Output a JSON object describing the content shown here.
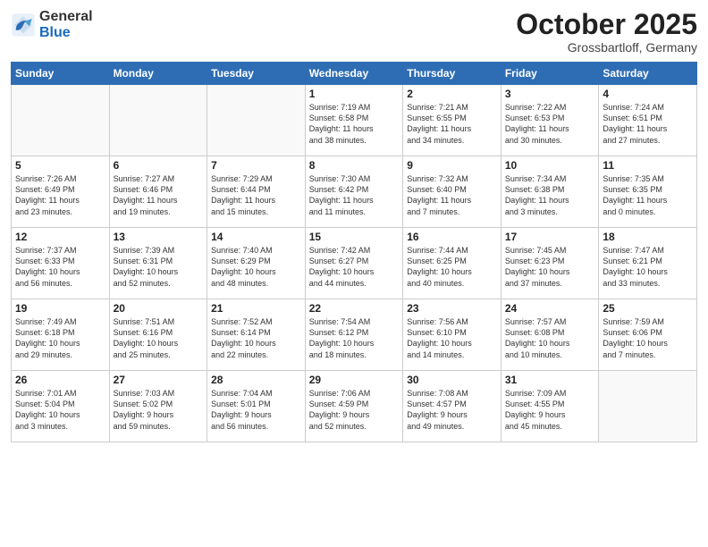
{
  "logo": {
    "general": "General",
    "blue": "Blue"
  },
  "title": "October 2025",
  "location": "Grossbartloff, Germany",
  "weekdays": [
    "Sunday",
    "Monday",
    "Tuesday",
    "Wednesday",
    "Thursday",
    "Friday",
    "Saturday"
  ],
  "weeks": [
    [
      {
        "num": "",
        "info": ""
      },
      {
        "num": "",
        "info": ""
      },
      {
        "num": "",
        "info": ""
      },
      {
        "num": "1",
        "info": "Sunrise: 7:19 AM\nSunset: 6:58 PM\nDaylight: 11 hours\nand 38 minutes."
      },
      {
        "num": "2",
        "info": "Sunrise: 7:21 AM\nSunset: 6:55 PM\nDaylight: 11 hours\nand 34 minutes."
      },
      {
        "num": "3",
        "info": "Sunrise: 7:22 AM\nSunset: 6:53 PM\nDaylight: 11 hours\nand 30 minutes."
      },
      {
        "num": "4",
        "info": "Sunrise: 7:24 AM\nSunset: 6:51 PM\nDaylight: 11 hours\nand 27 minutes."
      }
    ],
    [
      {
        "num": "5",
        "info": "Sunrise: 7:26 AM\nSunset: 6:49 PM\nDaylight: 11 hours\nand 23 minutes."
      },
      {
        "num": "6",
        "info": "Sunrise: 7:27 AM\nSunset: 6:46 PM\nDaylight: 11 hours\nand 19 minutes."
      },
      {
        "num": "7",
        "info": "Sunrise: 7:29 AM\nSunset: 6:44 PM\nDaylight: 11 hours\nand 15 minutes."
      },
      {
        "num": "8",
        "info": "Sunrise: 7:30 AM\nSunset: 6:42 PM\nDaylight: 11 hours\nand 11 minutes."
      },
      {
        "num": "9",
        "info": "Sunrise: 7:32 AM\nSunset: 6:40 PM\nDaylight: 11 hours\nand 7 minutes."
      },
      {
        "num": "10",
        "info": "Sunrise: 7:34 AM\nSunset: 6:38 PM\nDaylight: 11 hours\nand 3 minutes."
      },
      {
        "num": "11",
        "info": "Sunrise: 7:35 AM\nSunset: 6:35 PM\nDaylight: 11 hours\nand 0 minutes."
      }
    ],
    [
      {
        "num": "12",
        "info": "Sunrise: 7:37 AM\nSunset: 6:33 PM\nDaylight: 10 hours\nand 56 minutes."
      },
      {
        "num": "13",
        "info": "Sunrise: 7:39 AM\nSunset: 6:31 PM\nDaylight: 10 hours\nand 52 minutes."
      },
      {
        "num": "14",
        "info": "Sunrise: 7:40 AM\nSunset: 6:29 PM\nDaylight: 10 hours\nand 48 minutes."
      },
      {
        "num": "15",
        "info": "Sunrise: 7:42 AM\nSunset: 6:27 PM\nDaylight: 10 hours\nand 44 minutes."
      },
      {
        "num": "16",
        "info": "Sunrise: 7:44 AM\nSunset: 6:25 PM\nDaylight: 10 hours\nand 40 minutes."
      },
      {
        "num": "17",
        "info": "Sunrise: 7:45 AM\nSunset: 6:23 PM\nDaylight: 10 hours\nand 37 minutes."
      },
      {
        "num": "18",
        "info": "Sunrise: 7:47 AM\nSunset: 6:21 PM\nDaylight: 10 hours\nand 33 minutes."
      }
    ],
    [
      {
        "num": "19",
        "info": "Sunrise: 7:49 AM\nSunset: 6:18 PM\nDaylight: 10 hours\nand 29 minutes."
      },
      {
        "num": "20",
        "info": "Sunrise: 7:51 AM\nSunset: 6:16 PM\nDaylight: 10 hours\nand 25 minutes."
      },
      {
        "num": "21",
        "info": "Sunrise: 7:52 AM\nSunset: 6:14 PM\nDaylight: 10 hours\nand 22 minutes."
      },
      {
        "num": "22",
        "info": "Sunrise: 7:54 AM\nSunset: 6:12 PM\nDaylight: 10 hours\nand 18 minutes."
      },
      {
        "num": "23",
        "info": "Sunrise: 7:56 AM\nSunset: 6:10 PM\nDaylight: 10 hours\nand 14 minutes."
      },
      {
        "num": "24",
        "info": "Sunrise: 7:57 AM\nSunset: 6:08 PM\nDaylight: 10 hours\nand 10 minutes."
      },
      {
        "num": "25",
        "info": "Sunrise: 7:59 AM\nSunset: 6:06 PM\nDaylight: 10 hours\nand 7 minutes."
      }
    ],
    [
      {
        "num": "26",
        "info": "Sunrise: 7:01 AM\nSunset: 5:04 PM\nDaylight: 10 hours\nand 3 minutes."
      },
      {
        "num": "27",
        "info": "Sunrise: 7:03 AM\nSunset: 5:02 PM\nDaylight: 9 hours\nand 59 minutes."
      },
      {
        "num": "28",
        "info": "Sunrise: 7:04 AM\nSunset: 5:01 PM\nDaylight: 9 hours\nand 56 minutes."
      },
      {
        "num": "29",
        "info": "Sunrise: 7:06 AM\nSunset: 4:59 PM\nDaylight: 9 hours\nand 52 minutes."
      },
      {
        "num": "30",
        "info": "Sunrise: 7:08 AM\nSunset: 4:57 PM\nDaylight: 9 hours\nand 49 minutes."
      },
      {
        "num": "31",
        "info": "Sunrise: 7:09 AM\nSunset: 4:55 PM\nDaylight: 9 hours\nand 45 minutes."
      },
      {
        "num": "",
        "info": ""
      }
    ]
  ]
}
